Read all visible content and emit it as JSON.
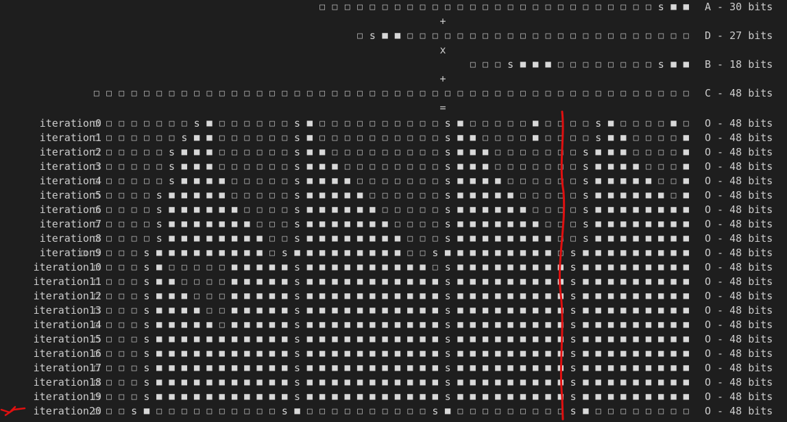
{
  "terminal": {
    "background": "#1e1e1e",
    "text_color": "#cccccc",
    "glyphs": {
      "empty": "□",
      "full": "■",
      "sign": "s"
    },
    "operands": [
      {
        "label": "A - 30 bits",
        "pattern": "eeeeeeeeeeeeeeeeeeeeeeeeeeeSFF"
      },
      {
        "label": "D - 27 bits",
        "pattern": "eSFFeeeeeeeeeeeeeeeeeeeeeee"
      },
      {
        "label": "B - 18 bits",
        "pattern": "eeeSFFFeeeeeeeeSFF"
      },
      {
        "label": "C - 48 bits",
        "pattern": "eeeeeeeeeeeeeeeeeeeeeeeeeeeeeeeeeeeeeeeeeeeeeeee"
      }
    ],
    "operators": [
      "+",
      "x",
      "+",
      "="
    ],
    "iterations": [
      {
        "label": "iteration0",
        "suffix": "O - 48 bits",
        "pattern": "eeeeeeeeSFeeeeeeSFeeeeeeeeeeSFeeeeeFeeeeSFeeeeFe"
      },
      {
        "label": "iteration1",
        "suffix": "O - 48 bits",
        "pattern": "eeeeeeeSFFeeeeeeSFeeeeeeeeeeSFFeeeeFeeeeSFFeeeeF"
      },
      {
        "label": "iteration2",
        "suffix": "O - 48 bits",
        "pattern": "eeeeeeSFFFeeeeeeSFFeeeeeeeeeSFFFeeeeeeeSFFFeeeeF"
      },
      {
        "label": "iteration3",
        "suffix": "O - 48 bits",
        "pattern": "eeeeeeSFFFeeeeeeSFFFeeeeeeeeSFFFeeeeeeeSFFFFeeeF"
      },
      {
        "label": "iteration4",
        "suffix": "O - 48 bits",
        "pattern": "eeeeeeSFFFFeeeeeSFFFFeeeeeeeSFFFFeeeeeeSFFFFFeeF"
      },
      {
        "label": "iteration5",
        "suffix": "O - 48 bits",
        "pattern": "eeeeeSFFFFFeeeeeSFFFFFeeeeeeSFFFFFeeeeeSFFFFFFeF"
      },
      {
        "label": "iteration6",
        "suffix": "O - 48 bits",
        "pattern": "eeeeeSFFFFFFeeeeSFFFFFFeeeeeSFFFFFFeeeeSFFFFFFFF"
      },
      {
        "label": "iteration7",
        "suffix": "O - 48 bits",
        "pattern": "eeeeeSFFFFFFFeeeSFFFFFFFeeeeSFFFFFFFeeeSFFFFFFFF"
      },
      {
        "label": "iteration8",
        "suffix": "O - 48 bits",
        "pattern": "eeeeeSFFFFFFFFeeSFFFFFFFFeeeSFFFFFFFFeeSFFFFFFFF"
      },
      {
        "label": "iteration9",
        "suffix": "O - 48 bits",
        "pattern": "eeeeeSFFFFFFFFFeSFFFFFFFFFeeSFFFFFFFFFeSFFFFFFFFF"
      },
      {
        "label": "iteration10",
        "suffix": "O - 48 bits",
        "pattern": "eeeeSFeeeeeFFFFFSFFFFFFFFFFeSFFFFFFFFFSFFFFFFFFF"
      },
      {
        "label": "iteration11",
        "suffix": "O - 48 bits",
        "pattern": "eeeeSFFeeeeFFFFFSFFFFFFFFFFFSFFFFFFFFFSFFFFFFFFF"
      },
      {
        "label": "iteration12",
        "suffix": "O - 48 bits",
        "pattern": "eeeeSFFFeeeFFFFFSFFFFFFFFFFFSFFFFFFFFFSFFFFFFFFF"
      },
      {
        "label": "iteration13",
        "suffix": "O - 48 bits",
        "pattern": "eeeeSFFFFeeFFFFFSFFFFFFFFFFFSFFFFFFFFFSFFFFFFFFF"
      },
      {
        "label": "iteration14",
        "suffix": "O - 48 bits",
        "pattern": "eeeeSFFFFFeFFFFFSFFFFFFFFFFFSFFFFFFFFFSFFFFFFFFF"
      },
      {
        "label": "iteration15",
        "suffix": "O - 48 bits",
        "pattern": "eeeeSFFFFFFFFFFFSFFFFFFFFFFFSFFFFFFFFFSFFFFFFFFF"
      },
      {
        "label": "iteration16",
        "suffix": "O - 48 bits",
        "pattern": "eeeeSFFFFFFFFFFFSFFFFFFFFFFFSFFFFFFFFFSFFFFFFFFF"
      },
      {
        "label": "iteration17",
        "suffix": "O - 48 bits",
        "pattern": "eeeeSFFFFFFFFFFFSFFFFFFFFFFFSFFFFFFFFFSFFFFFFFFF"
      },
      {
        "label": "iteration18",
        "suffix": "O - 48 bits",
        "pattern": "eeeeSFFFFFFFFFFFSFFFFFFFFFFFSFFFFFFFFFSFFFFFFFFF"
      },
      {
        "label": "iteration19",
        "suffix": "O - 48 bits",
        "pattern": "eeeeSFFFFFFFFFFFSFFFFFFFFFFFSFFFFFFFFFSFFFFFFFFF"
      },
      {
        "label": "iteration20",
        "suffix": "O - 48 bits",
        "pattern": "eeeSFeeeeeeeeeeSFeeeeeeeeeeSFeeeeeeeeeSFeeeeeeee"
      }
    ]
  },
  "annotations": {
    "ink_color": "#e01010"
  }
}
